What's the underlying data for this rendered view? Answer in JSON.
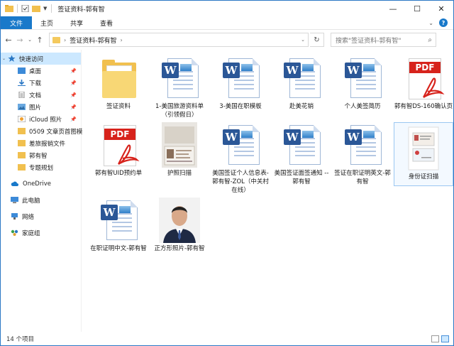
{
  "window": {
    "title": "签证资料-郭有智"
  },
  "ribbon": {
    "tabs": [
      "文件",
      "主页",
      "共享",
      "查看"
    ]
  },
  "address": {
    "path": "签证资料-郭有智"
  },
  "search": {
    "placeholder": "搜索\"签证资料-郭有智\""
  },
  "nav": {
    "quick_access": "快速访问",
    "items": [
      {
        "label": "桌面",
        "pinned": true
      },
      {
        "label": "下载",
        "pinned": true
      },
      {
        "label": "文档",
        "pinned": true
      },
      {
        "label": "图片",
        "pinned": true
      },
      {
        "label": "iCloud 照片",
        "pinned": true
      },
      {
        "label": "0509 文章页首图模",
        "pinned": false
      },
      {
        "label": "差旅报销文件",
        "pinned": false
      },
      {
        "label": "郭有智",
        "pinned": false
      },
      {
        "label": "专题规划",
        "pinned": false
      }
    ],
    "onedrive": "OneDrive",
    "this_pc": "此电脑",
    "network": "网络",
    "homegroup": "家庭组"
  },
  "files": [
    {
      "name": "签证资料",
      "kind": "folder"
    },
    {
      "name": "1-美国旅游资料单（引领假日）",
      "kind": "word"
    },
    {
      "name": "3-美国在职模板",
      "kind": "word"
    },
    {
      "name": "赴美花销",
      "kind": "word"
    },
    {
      "name": "个人美签简历",
      "kind": "word"
    },
    {
      "name": "郭有智DS-160确认页",
      "kind": "pdf"
    },
    {
      "name": "郭有智UID预约单",
      "kind": "pdf"
    },
    {
      "name": "护照扫描",
      "kind": "passport"
    },
    {
      "name": "美国签证个人信息表-郭有智-ZOL（中关村在线）",
      "kind": "word"
    },
    {
      "name": "美国签证面签通知 --郭有智",
      "kind": "word"
    },
    {
      "name": "签证在职证明英文-郭有智",
      "kind": "word"
    },
    {
      "name": "身份证扫描",
      "kind": "idcard",
      "selected": true
    },
    {
      "name": "在职证明中文-郭有智",
      "kind": "word"
    },
    {
      "name": "正方形照片-郭有智",
      "kind": "portrait"
    }
  ],
  "status": {
    "count": "14 个项目"
  },
  "colors": {
    "accent": "#1979ca",
    "folder": "#f1c04f",
    "pdf": "#d7231c",
    "word": "#2b5797"
  }
}
